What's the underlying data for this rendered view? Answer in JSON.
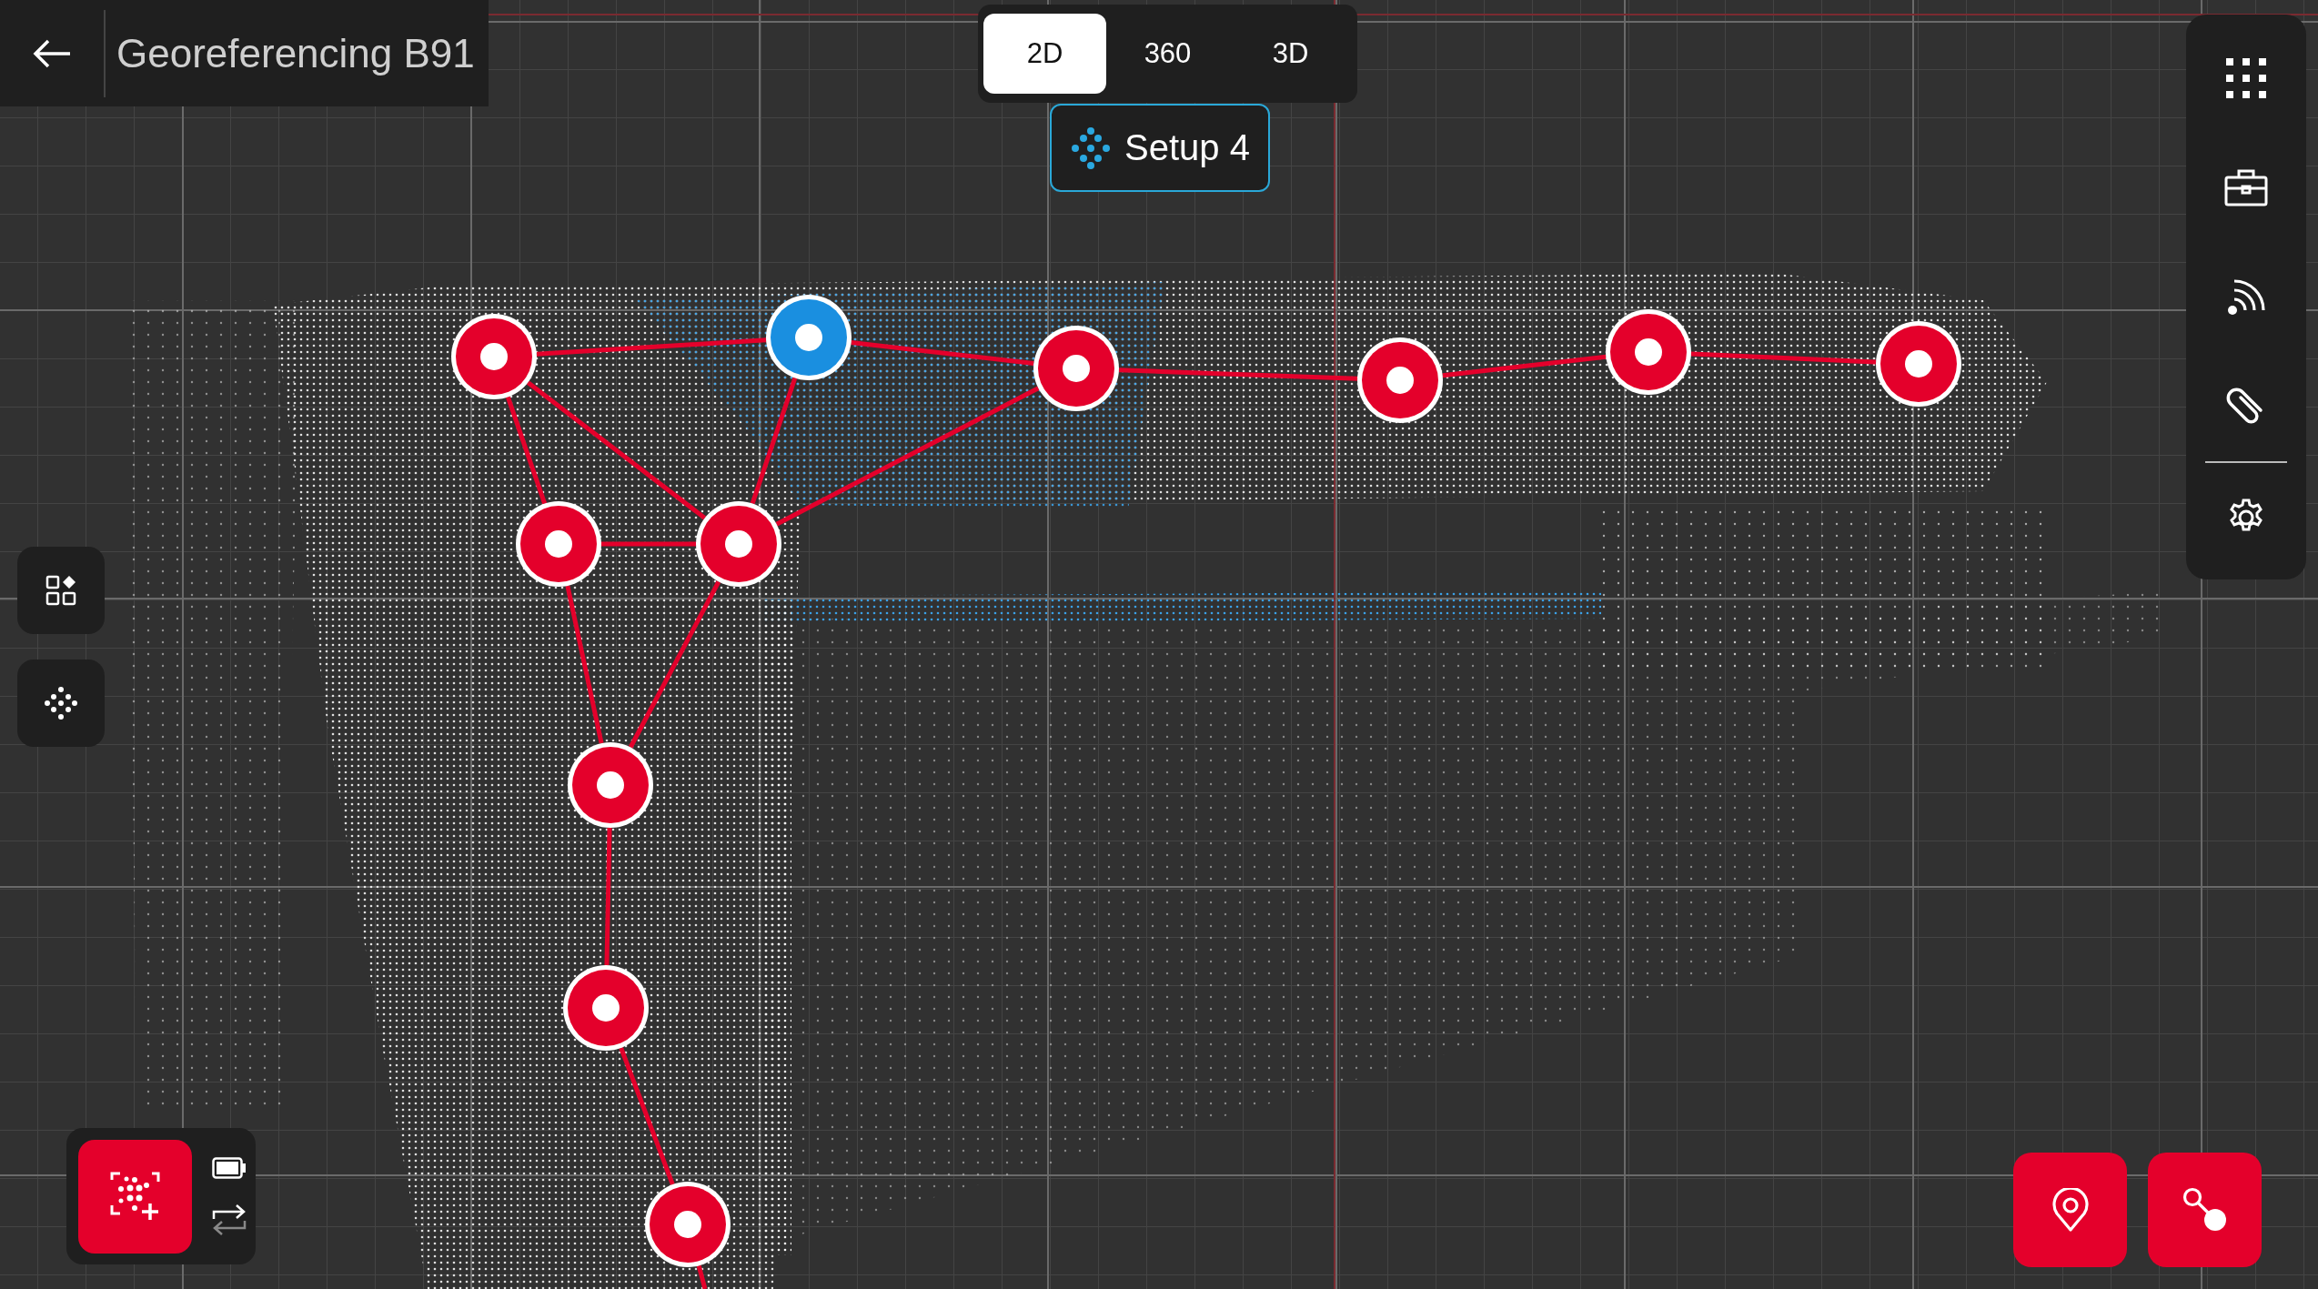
{
  "header": {
    "title": "Georeferencing B91"
  },
  "view_tabs": [
    {
      "label": "2D",
      "selected": true
    },
    {
      "label": "360",
      "selected": false
    },
    {
      "label": "3D",
      "selected": false
    }
  ],
  "setup_chip": {
    "label": "Setup 4"
  },
  "setups": [
    {
      "selected": false
    },
    {
      "selected": true
    },
    {
      "selected": false
    },
    {
      "selected": false
    },
    {
      "selected": false
    },
    {
      "selected": false
    },
    {
      "selected": false
    },
    {
      "selected": false
    },
    {
      "selected": false
    },
    {
      "selected": false
    },
    {
      "selected": false
    }
  ]
}
